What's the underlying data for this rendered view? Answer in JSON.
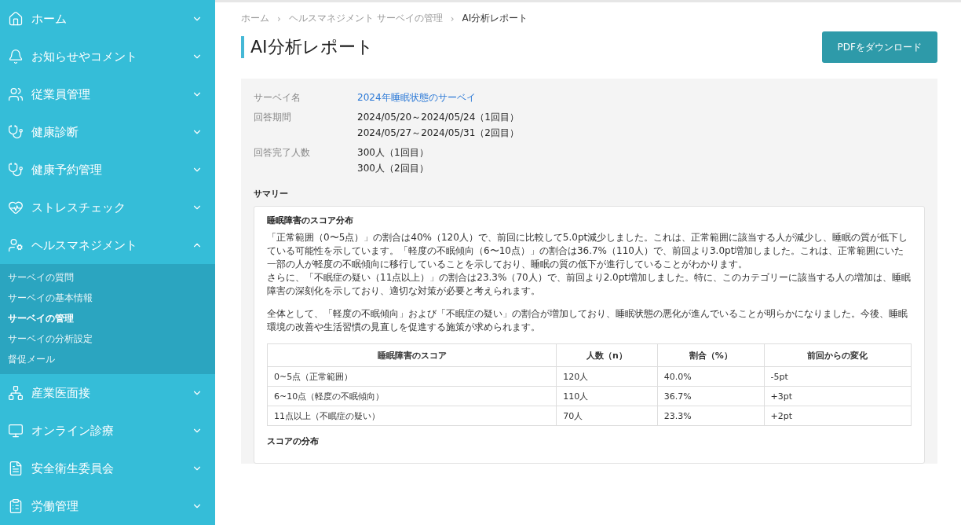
{
  "sidebar": {
    "items": [
      {
        "label": "ホーム",
        "expanded": false
      },
      {
        "label": "お知らせやコメント",
        "expanded": false
      },
      {
        "label": "従業員管理",
        "expanded": false
      },
      {
        "label": "健康診断",
        "expanded": false
      },
      {
        "label": "健康予約管理",
        "expanded": false
      },
      {
        "label": "ストレスチェック",
        "expanded": false
      },
      {
        "label": "ヘルスマネジメント",
        "expanded": true,
        "children": [
          {
            "label": "サーベイの質問",
            "selected": false
          },
          {
            "label": "サーベイの基本情報",
            "selected": false
          },
          {
            "label": "サーベイの管理",
            "selected": true
          },
          {
            "label": "サーベイの分析設定",
            "selected": false
          },
          {
            "label": "督促メール",
            "selected": false
          }
        ]
      },
      {
        "label": "産業医面接",
        "expanded": false
      },
      {
        "label": "オンライン診療",
        "expanded": false
      },
      {
        "label": "安全衛生委員会",
        "expanded": false
      },
      {
        "label": "労働管理",
        "expanded": false
      }
    ]
  },
  "breadcrumb_separator": "›",
  "breadcrumb": [
    {
      "label": "ホーム",
      "current": false
    },
    {
      "label": "ヘルスマネジメント サーベイの管理",
      "current": false
    },
    {
      "label": "AI分析レポート",
      "current": true
    }
  ],
  "page_title": "AI分析レポート",
  "download_button": "PDFをダウンロード",
  "survey_info": [
    {
      "label": "サーベイ名",
      "kind": "link",
      "values": [
        "2024年睡眠状態のサーベイ"
      ]
    },
    {
      "label": "回答期間",
      "kind": "text",
      "values": [
        "2024/05/20～2024/05/24（1回目）",
        "2024/05/27～2024/05/31（2回目）"
      ]
    },
    {
      "label": "回答完了人数",
      "kind": "text",
      "values": [
        "300人（1回目）",
        "300人（2回目）"
      ]
    }
  ],
  "summary": {
    "heading": "サマリー",
    "card_title": "睡眠障害のスコア分布",
    "paragraphs": [
      "「正常範囲（0〜5点）」の割合は40%（120人）で、前回に比較して5.0pt減少しました。これは、正常範囲に該当する人が減少し、睡眠の質が低下している可能性を示しています。「軽度の不眠傾向（6〜10点）」の割合は36.7%（110人）で、前回より3.0pt増加しました。これは、正常範囲にいた一部の人が軽度の不眠傾向に移行していることを示しており、睡眠の質の低下が進行していることがわかります。",
      "さらに、「不眠症の疑い（11点以上）」の割合は23.3%（70人）で、前回より2.0pt増加しました。特に、このカテゴリーに該当する人の増加は、睡眠障害の深刻化を示しており、適切な対策が必要と考えられます。",
      "全体として、「軽度の不眠傾向」および「不眠症の疑い」の割合が増加しており、睡眠状態の悪化が進んでいることが明らかになりました。今後、睡眠環境の改善や生活習慣の見直しを促進する施策が求められます。"
    ],
    "table": {
      "columns": [
        "睡眠障害のスコア",
        "人数（n）",
        "割合（%）",
        "前回からの変化"
      ],
      "rows": [
        [
          "0~5点（正常範囲）",
          "120人",
          "40.0%",
          "-5pt"
        ],
        [
          "6~10点（軽度の不眠傾向）",
          "110人",
          "36.7%",
          "+3pt"
        ],
        [
          "11点以上（不眠症の疑い）",
          "70人",
          "23.3%",
          "+2pt"
        ]
      ]
    },
    "next_heading": "スコアの分布"
  }
}
